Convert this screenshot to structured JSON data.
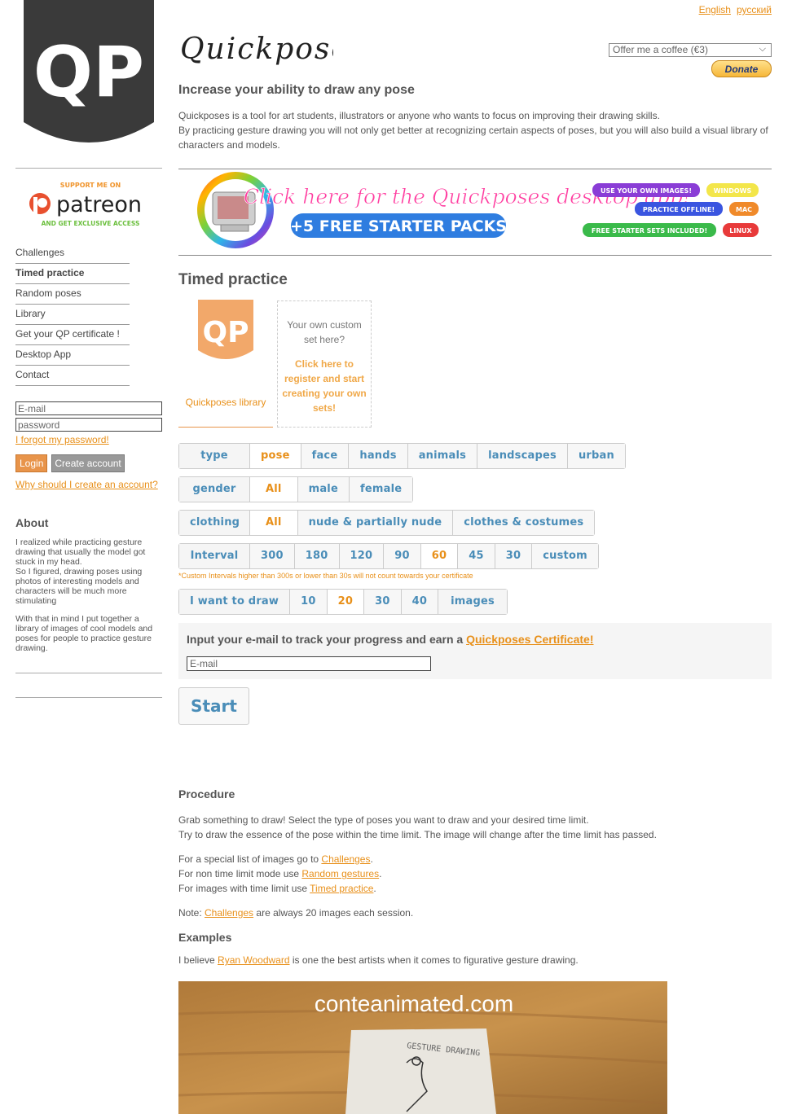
{
  "header": {
    "languages": [
      "English",
      "русский"
    ],
    "wordmark": "Quickposes",
    "logo_text": "QP",
    "donate_select": "Offer me a coffee (€3)",
    "donate_button": "Donate",
    "tagline": "Increase your ability to draw any pose",
    "intro": [
      "Quickposes is a tool for art students, illustrators or anyone who wants to focus on improving their drawing skills.",
      "By practicing gesture drawing you will not only get better at recognizing certain aspects of poses, but you will also build a visual library of characters and models."
    ]
  },
  "patreon": {
    "top": "SUPPORT ME ON",
    "brand": "patreon",
    "bottom": "AND GET EXCLUSIVE ACCESS"
  },
  "nav": [
    {
      "label": "Challenges",
      "active": false
    },
    {
      "label": "Timed practice",
      "active": true
    },
    {
      "label": "Random poses",
      "active": false
    },
    {
      "label": "Library",
      "active": false
    },
    {
      "label": "Get your QP certificate !",
      "active": false
    },
    {
      "label": "Desktop App",
      "active": false
    },
    {
      "label": "Contact",
      "active": false
    }
  ],
  "login": {
    "email_value": "E-mail",
    "password_value": "password",
    "forgot": "I forgot my password!",
    "login_button": "Login",
    "create_button": "Create account",
    "why": "Why should I create an account?"
  },
  "about": {
    "title": "About",
    "p1": "I realized while practicing gesture drawing that usually the model got stuck in my head.",
    "p1b": "So I figured, drawing poses using photos of interesting models and characters will be much more stimulating",
    "p2": "With that in mind I put together a library of images of cool models and poses for people to practice gesture drawing."
  },
  "banner": {
    "headline": "Click here for the Quickposes desktop app!",
    "subline": "+5 FREE STARTER PACKS",
    "badges": [
      "USE YOUR OWN IMAGES!",
      "WINDOWS",
      "PRACTICE OFFLINE!",
      "MAC",
      "FREE STARTER SETS INCLUDED!",
      "LINUX"
    ]
  },
  "timed": {
    "title": "Timed practice",
    "library_label": "Quickposes library",
    "custom_q": "Your own custom set here?",
    "custom_cta": "Click here to register and start creating your own sets!",
    "rows": {
      "type": [
        "type",
        "pose",
        "face",
        "hands",
        "animals",
        "landscapes",
        "urban"
      ],
      "gender": [
        "gender",
        "All",
        "male",
        "female"
      ],
      "clothing": [
        "clothing",
        "All",
        "nude & partially nude",
        "clothes & costumes"
      ],
      "interval": [
        "Interval",
        "300",
        "180",
        "120",
        "90",
        "60",
        "45",
        "30",
        "custom"
      ],
      "count": [
        "I want to draw",
        "10",
        "20",
        "30",
        "40",
        "images"
      ]
    },
    "selected": {
      "type": "pose",
      "gender": "All",
      "clothing": "All",
      "interval": "60",
      "count": "20"
    },
    "interval_note": "*Custom Intervals higher than 300s or lower than 30s will not count towards your certificate",
    "email_prompt": "Input your e-mail to track your progress and earn a ",
    "email_link": "Quickposes Certificate!",
    "email_value": "E-mail",
    "start": "Start"
  },
  "procedure": {
    "title": "Procedure",
    "l1": "Grab something to draw! Select the type of poses you want to draw and your desired time limit.",
    "l2": "Try to draw the essence of the pose within the time limit. The image will change after the time limit has passed.",
    "l3a": "For a special list of images go to ",
    "l3link": "Challenges",
    "l3b": ".",
    "l4a": "For non time limit mode use ",
    "l4link": "Random gestures",
    "l4b": ".",
    "l5a": "For images with time limit use ",
    "l5link": "Timed practice",
    "l5b": ".",
    "l6a": "Note: ",
    "l6link": "Challenges",
    "l6b": " are always 20 images each session.",
    "examples_title": "Examples",
    "l7a": "I believe ",
    "l7link": "Ryan Woodward",
    "l7b": " is one the best artists when it comes to figurative gesture drawing.",
    "video_caption": "conteanimated.com",
    "paper_text": "GESTURE DRAWING"
  },
  "colors": {
    "accent": "#e8901a",
    "link_blue": "#4a8db8",
    "dark": "#3a3a3a"
  }
}
